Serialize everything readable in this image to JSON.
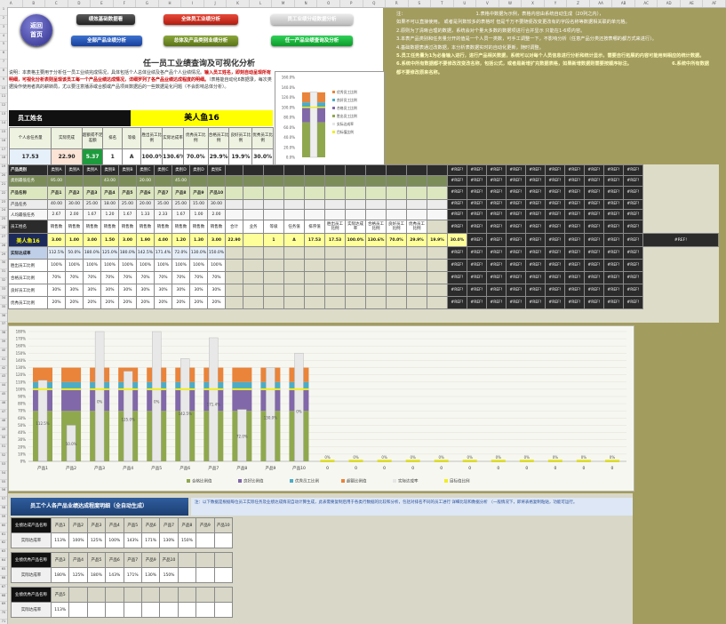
{
  "column_letters": [
    "A",
    "B",
    "C",
    "D",
    "E",
    "F",
    "G",
    "H",
    "I",
    "J",
    "K",
    "L",
    "M",
    "N",
    "O",
    "P",
    "Q",
    "R",
    "S",
    "T",
    "U",
    "V",
    "W",
    "X",
    "Y",
    "Z",
    "AA",
    "AB",
    "AC",
    "AD",
    "AE",
    "AF"
  ],
  "nav": {
    "home_line1": "返回",
    "home_line2": "首页",
    "btn_basic": "绩效基础数据看",
    "btn_all_perf": "全体员工业绩分析",
    "btn_group_perf": "员工业绩分组数据分析",
    "btn_all_product": "全部产品业绩分析",
    "btn_category": "总体及产品类别业绩分析",
    "btn_single": "任一产品业绩查询及分析"
  },
  "title": "任一员工业绩查询及可视化分析",
  "desc": {
    "p1": "说明：本表格主要用于分析任一员工业绩完成情况，具体包括个人总体业绩及各产品个人业绩情况。",
    "p2": "输入员工姓名，即刻自动呈现所有明细，可视化分析表则呈现该员工每一个产品业绩达成情况，详细罗列了各产品业绩达成程度的明细。",
    "p3": "（表格能自动化6数据录，每次类据操作使用者高的耕转局，尤以要注意播添或合额或产品项目数据后的一些数据是化问题（不会影响总体分析）。"
  },
  "employee": {
    "label": "员工姓名",
    "name": "美人鱼16"
  },
  "summary": {
    "headers": [
      "个人总任务量",
      "实际完成",
      "超额或不足差额",
      "排名",
      "等级",
      "胜出员工比例",
      "实际达成率",
      "优秀员工比例",
      "合格员工比例",
      "良好员工比例",
      "优秀员工比例"
    ],
    "values": [
      "17.53",
      "22.90",
      "5.37",
      "1",
      "A",
      "100.0%",
      "130.6%",
      "70.0%",
      "29.9%",
      "19.9%",
      "30.0%"
    ]
  },
  "mini_chart": {
    "y_ticks": [
      "160.0%",
      "140.0%",
      "120.0%",
      "100.0%",
      "80.0%",
      "60.0%",
      "40.0%",
      "20.0%",
      "0.0%"
    ],
    "legend": [
      "优秀员工比例",
      "良好员工比例",
      "合格员工比例",
      "胜出员工比例",
      "实际达成率",
      "目标值比例"
    ]
  },
  "grid": {
    "row_labels": [
      "产品类别",
      "类别最低任务",
      "产品名称",
      "产品任务",
      "人均最低任务",
      "员工姓名",
      "美人鱼16",
      "实际达成率",
      "胜出员工比例",
      "合格员工比例",
      "良好员工比例",
      "优秀员工比例"
    ],
    "category_row": [
      "类别A",
      "类别A",
      "类别A",
      "类别B",
      "类别B",
      "类别C",
      "类别C",
      "类别D",
      "类别D",
      "类别E"
    ],
    "category_min_row": [
      "95.00",
      "",
      "",
      "43.00",
      "",
      "20.00",
      "",
      "45.00",
      "",
      ""
    ],
    "product_names": [
      "产品1",
      "产品2",
      "产品3",
      "产品4",
      "产品5",
      "产品6",
      "产品7",
      "产品8",
      "产品9",
      "产品10"
    ],
    "product_tasks": [
      "40.00",
      "30.00",
      "25.00",
      "18.00",
      "25.00",
      "20.00",
      "35.00",
      "25.00",
      "15.00",
      "30.00"
    ],
    "per_min": [
      "2.67",
      "2.00",
      "1.67",
      "1.20",
      "1.67",
      "1.33",
      "2.33",
      "1.67",
      "1.00",
      "2.00"
    ],
    "sales_label": "销售数",
    "sales_values": [
      "3.00",
      "1.00",
      "3.00",
      "1.50",
      "3.00",
      "1.90",
      "4.00",
      "1.20",
      "1.30",
      "3.00",
      "22.90"
    ],
    "extra_headers": [
      "合计",
      "业务",
      "等级",
      "任务值",
      "排序值",
      "胜出员工比例",
      "实际达成率",
      "合格员工比例",
      "良好员工比例",
      "优秀员工比例"
    ],
    "extra_values": [
      "",
      "1",
      "A",
      "17.53",
      "17.53",
      "100.0%",
      "130.6%",
      "70.0%",
      "29.9%",
      "19.9%",
      "30.0%"
    ],
    "achieve": [
      "112.5%",
      "50.0%",
      "180.0%",
      "125.0%",
      "180.0%",
      "142.5%",
      "171.4%",
      "72.0%",
      "130.0%",
      "150.0%"
    ],
    "win_pct": [
      "100%",
      "100%",
      "100%",
      "100%",
      "100%",
      "100%",
      "100%",
      "100%",
      "100%",
      "100%"
    ],
    "qual_pct": [
      "70%",
      "70%",
      "70%",
      "70%",
      "70%",
      "70%",
      "70%",
      "70%",
      "70%",
      "70%"
    ],
    "good_pct": [
      "30%",
      "30%",
      "30%",
      "30%",
      "30%",
      "30%",
      "30%",
      "30%",
      "30%",
      "30%"
    ],
    "exc_pct": [
      "20%",
      "20%",
      "20%",
      "20%",
      "20%",
      "20%",
      "20%",
      "20%",
      "20%",
      "20%"
    ],
    "exc2_pct": [
      "30%",
      "30%",
      "30%",
      "30%",
      "30%",
      "30%",
      "30%",
      "30%",
      "30%",
      "30%"
    ],
    "ref_label": "#REF!"
  },
  "notes": {
    "lines": [
      "注：                                                1.表格中数据为示例，表格内容由系统自动生成（20列之内），",
      "如果不可以直接使用。 或者是列数较多的表格时 但是千万不要随便改变更改有的字段名称等数据相关联的单元格。",
      "2.原则为了清晰合理的数据，系统会对个量大多数的数据项进行合并显示 只能在1-6项内容。",
      "3.本表产品类别和任务量分开的值是一个人员一类数，可手工调整一下，不影响分析（任意产品分类还按表哪的都方式来进行）。",
      "4.基础数据表通过改数据，本分析表数据实时的自动化更新，随时调整。",
      "5.员工任务量为1为必备输入进行，进行产品相关数据，系统可以对每个人员信息进行分析和统计显示，需要自行拓展的内容可能用到相应的统计数据。",
      "6.系统中所有数据都不要修改改变改名称，包括公式，或者是新增扩充数据表格，如果新增数据则需要按顺序标注。                         6.系统中所有数据都不要修改原来名称。"
    ]
  },
  "chart_data": {
    "type": "bar",
    "stacked": true,
    "title": "",
    "categories": [
      "产品1",
      "产品2",
      "产品3",
      "产品4",
      "产品5",
      "产品6",
      "产品7",
      "产品8",
      "产品9",
      "产品10",
      "0",
      "0",
      "0",
      "0",
      "0",
      "0",
      "0",
      "0",
      "0",
      "0",
      "0"
    ],
    "y_ticks": [
      "180%",
      "170%",
      "160%",
      "150%",
      "140%",
      "130%",
      "120%",
      "110%",
      "100%",
      "90%",
      "80%",
      "70%",
      "60%",
      "50%",
      "40%",
      "30%",
      "20%",
      "10%",
      "0%"
    ],
    "ylim": [
      0,
      1.8
    ],
    "series": [
      {
        "name": "合格比例值",
        "values": [
          0.7,
          0.7,
          0.7,
          0.7,
          0.7,
          0.7,
          0.7,
          0.7,
          0.7,
          0.7,
          0,
          0,
          0,
          0,
          0,
          0,
          0,
          0,
          0,
          0,
          0
        ],
        "color": "#8fa84e"
      },
      {
        "name": "良好比例值",
        "values": [
          0.3,
          0.3,
          0.3,
          0.3,
          0.3,
          0.3,
          0.3,
          0.3,
          0.3,
          0.3,
          0,
          0,
          0,
          0,
          0,
          0,
          0,
          0,
          0,
          0,
          0
        ],
        "color": "#8168a8"
      },
      {
        "name": "优秀员工比例",
        "values": [
          0.1,
          0.1,
          0.1,
          0.1,
          0.1,
          0.1,
          0.1,
          0.1,
          0.1,
          0.1,
          0,
          0,
          0,
          0,
          0,
          0,
          0,
          0,
          0,
          0,
          0
        ],
        "color": "#4cacc6"
      },
      {
        "name": "超额比例值",
        "values": [
          0.2,
          0.2,
          0.2,
          0.2,
          0.2,
          0.2,
          0.2,
          0.2,
          0.2,
          0.2,
          0,
          0,
          0,
          0,
          0,
          0,
          0,
          0,
          0,
          0,
          0
        ],
        "color": "#e9843a"
      },
      {
        "name": "实际达成率",
        "values": [
          1.125,
          0.5,
          1.8,
          1.25,
          1.8,
          1.425,
          1.714,
          0.72,
          1.3,
          1.5,
          0,
          0,
          0,
          0,
          0,
          0,
          0,
          0,
          0,
          0,
          0
        ],
        "color": "#e6e6e6"
      },
      {
        "name": "目标值比例",
        "values": [
          1,
          1,
          1,
          1,
          1,
          1,
          1,
          1,
          1,
          1,
          0,
          0,
          0,
          0,
          0,
          0,
          0,
          0,
          0,
          0,
          0
        ],
        "color": "#f0ee22"
      }
    ],
    "data_labels": [
      "112.5%",
      "50.0%",
      "0%",
      "125.0%",
      "0%",
      "142.5%",
      "171.4%",
      "72.0%",
      "130.0%",
      "0%",
      "0%",
      "0%",
      "0%",
      "0%",
      "0%",
      "0%",
      "0%",
      "0%",
      "0%",
      "0%",
      "0%"
    ],
    "line_labels": [
      "0%",
      "0%",
      "0%",
      "0%",
      "0%",
      "0%",
      "0%",
      "0%",
      "0%",
      "0%",
      "0%"
    ]
  },
  "bottom": {
    "title": "员工个人各产品业绩达成程度明细（全自动生成）",
    "note": "注：以下数据是根据每位员工实际任务及业绩达成情况自动计算生成，此表需要复制后用于各类行数据的比较和分析，包括对排名不同的员工进行 详细比较和数据分析 （一般情况下，即将表格复制粘贴，功能可运行。",
    "blocks": [
      {
        "name_label": "业绩达成产品名称",
        "rate_label": "实际达成率",
        "products": [
          "产品1",
          "产品2",
          "产品3",
          "产品4",
          "产品5",
          "产品6",
          "产品7",
          "产品8",
          "产品9",
          "产品10"
        ],
        "rates": [
          "113%",
          "100%",
          "125%",
          "100%",
          "143%",
          "171%",
          "130%",
          "150%",
          "",
          ""
        ]
      },
      {
        "name_label": "业绩优秀产品名称",
        "rate_label": "实际达成率",
        "products": [
          "产品3",
          "产品4",
          "产品5",
          "产品6",
          "产品7",
          "产品9",
          "产品10",
          "",
          "",
          ""
        ],
        "rates": [
          "180%",
          "125%",
          "180%",
          "143%",
          "171%",
          "130%",
          "150%",
          "",
          "",
          ""
        ]
      },
      {
        "name_label": "业绩优秀产品名称",
        "rate_label": "实际达成率",
        "products": [
          "产品5",
          "",
          "",
          "",
          "",
          "",
          "",
          "",
          "",
          ""
        ],
        "rates": [
          "113%",
          "",
          "",
          "",
          "",
          "",
          "",
          "",
          "",
          ""
        ]
      }
    ]
  }
}
